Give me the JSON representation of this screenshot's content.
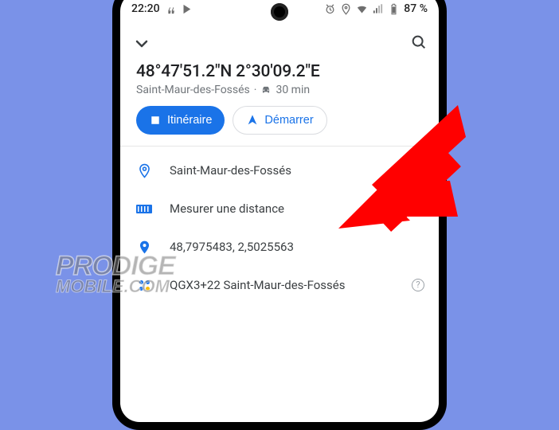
{
  "status": {
    "time": "22:20",
    "battery": "87 %"
  },
  "header": {
    "coords": "48°47'51.2\"N 2°30'09.2\"E",
    "locality": "Saint-Maur-des-Fossés",
    "dot": "·",
    "duration": "30 min"
  },
  "buttons": {
    "directions": "Itinéraire",
    "start": "Démarrer"
  },
  "items": {
    "place": "Saint-Maur-des-Fossés",
    "measure": "Mesurer une distance",
    "decimal_coords": "48,7975483, 2,5025563",
    "plus_code": "QGX3+22 Saint-Maur-des-Fossés"
  },
  "watermark": {
    "line1": "PRODIGE",
    "line2": "MOBILE.COM"
  }
}
